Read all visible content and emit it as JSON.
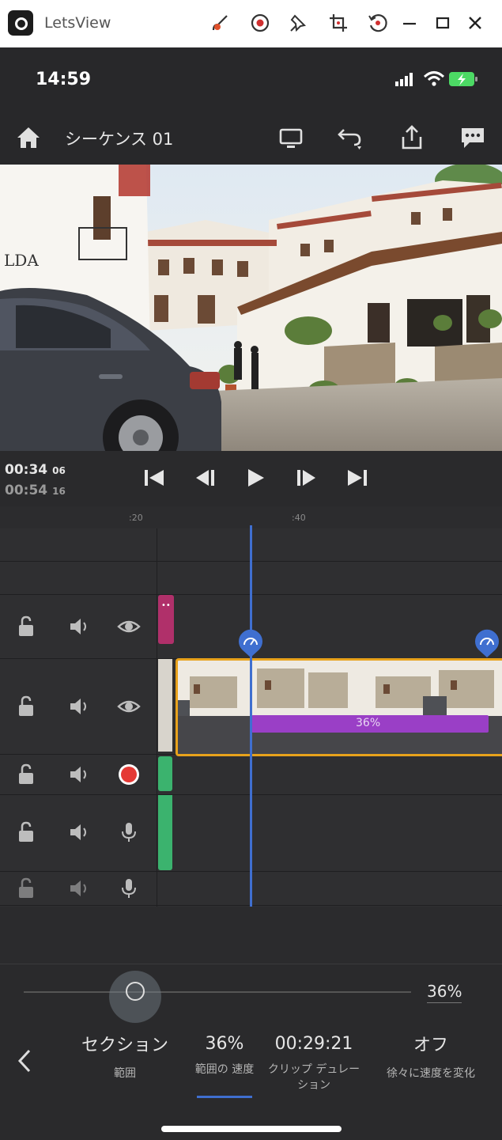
{
  "window": {
    "title": "LetsView"
  },
  "status": {
    "time": "14:59"
  },
  "header": {
    "sequence_title": "シーケンス 01"
  },
  "timecode": {
    "current": "00:34",
    "current_frames": "06",
    "total": "00:54",
    "total_frames": "16"
  },
  "ruler": {
    "marks": [
      ":20",
      ":40"
    ]
  },
  "clip": {
    "speed_label": "36%"
  },
  "panel": {
    "slider_value": "36%",
    "slider_fraction": 0.36,
    "options": [
      {
        "value": "セクション",
        "label": "範囲"
      },
      {
        "value": "36%",
        "label": "範囲の 速度"
      },
      {
        "value": "00:29:21",
        "label": "クリップ デュレーション"
      },
      {
        "value": "オフ",
        "label": "徐々に速度を変化"
      }
    ]
  },
  "colors": {
    "accent": "#3f6fd0",
    "clip_border": "#e8a21b",
    "speed_bar": "#9a3fc6",
    "record": "#e53935",
    "audio_clip": "#3bb36e",
    "title_clip": "#b0306a"
  }
}
